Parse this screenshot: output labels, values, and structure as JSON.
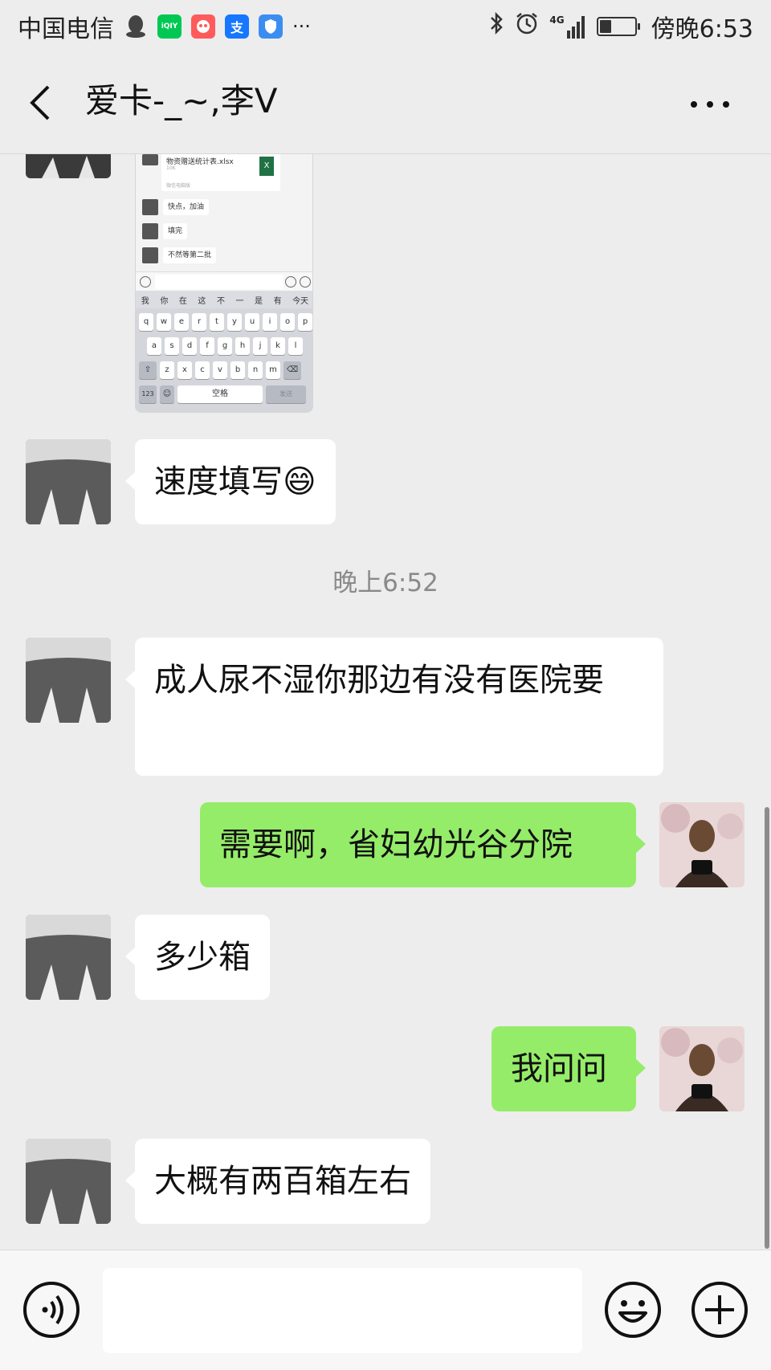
{
  "status_bar": {
    "carrier": "中国电信",
    "more": "···",
    "network": "4G",
    "time": "傍晚6:53",
    "battery_level": 0.35,
    "app_icons": [
      {
        "name": "qq-icon",
        "label": "",
        "color": "#555555"
      },
      {
        "name": "iqiyi-icon",
        "label": "iQIY",
        "color": "#00c853"
      },
      {
        "name": "xianyu-icon",
        "label": "",
        "color": "#ff5b5b"
      },
      {
        "name": "alipay-icon",
        "label": "支",
        "color": "#1677ff"
      },
      {
        "name": "shield-icon",
        "label": "",
        "color": "#3b8ef0"
      }
    ]
  },
  "header": {
    "title": "爱卡-_~,李V"
  },
  "screenshot_image": {
    "file_name": "物资赠送统计表.xlsx",
    "file_size": "10K",
    "file_source": "微信电脑版",
    "file_icon_label": "X",
    "messages": [
      "快点，加油",
      "填完",
      "不然等第二批"
    ],
    "candidates": [
      "我",
      "你",
      "在",
      "这",
      "不",
      "一",
      "是",
      "有",
      "今天"
    ],
    "key_rows": [
      [
        "q",
        "w",
        "e",
        "r",
        "t",
        "y",
        "u",
        "i",
        "o",
        "p"
      ],
      [
        "a",
        "s",
        "d",
        "f",
        "g",
        "h",
        "j",
        "k",
        "l"
      ],
      [
        "z",
        "x",
        "c",
        "v",
        "b",
        "n",
        "m"
      ]
    ],
    "key_123": "123",
    "key_space": "空格",
    "key_send": "发送"
  },
  "messages": [
    {
      "sender": "them",
      "text": "速度填写😄"
    },
    {
      "sender": "them",
      "text": "成人尿不湿你那边有没有医院要"
    },
    {
      "sender": "me",
      "text": "需要啊，省妇幼光谷分院"
    },
    {
      "sender": "them",
      "text": "多少箱"
    },
    {
      "sender": "me",
      "text": "我问问"
    },
    {
      "sender": "them",
      "text": "大概有两百箱左右"
    }
  ],
  "timestamp": "晚上6:52",
  "colors": {
    "background": "#ededed",
    "bubble_incoming": "#ffffff",
    "bubble_outgoing": "#95ec69"
  },
  "input_bar": {
    "placeholder": ""
  }
}
